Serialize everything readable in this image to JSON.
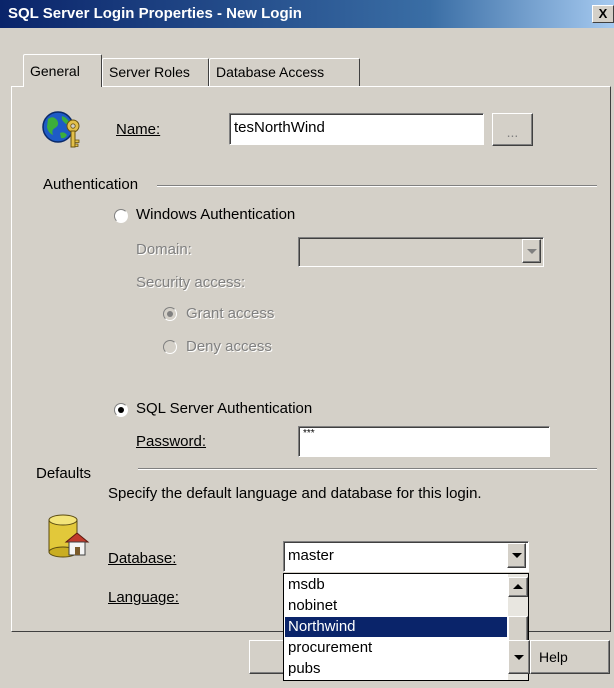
{
  "window": {
    "title": "SQL Server Login Properties - New Login",
    "close_glyph": "X"
  },
  "tabs": [
    {
      "label": "General",
      "active": true
    },
    {
      "label": "Server Roles",
      "active": false
    },
    {
      "label": "Database Access",
      "active": false
    }
  ],
  "general": {
    "name_label": "Name:",
    "name_value": "tesNorthWind",
    "browse_label": "...",
    "authentication_group": "Authentication",
    "windows_auth_label": "Windows Authentication",
    "domain_label": "Domain:",
    "security_access_label": "Security access:",
    "grant_access_label": "Grant access",
    "deny_access_label": "Deny access",
    "sql_auth_label": "SQL Server Authentication",
    "password_label": "Password:",
    "password_value": "***",
    "defaults_group": "Defaults",
    "defaults_description": "Specify the default language and database for this login.",
    "database_label": "Database:",
    "database_value": "master",
    "language_label": "Language:"
  },
  "database_dropdown": {
    "options": [
      "msdb",
      "nobinet",
      "Northwind",
      "procurement",
      "pubs"
    ],
    "highlighted": "Northwind"
  },
  "footer": {
    "help_label": "Help"
  },
  "icons": {
    "login": "globe-key-icon",
    "defaults": "database-home-icon"
  }
}
